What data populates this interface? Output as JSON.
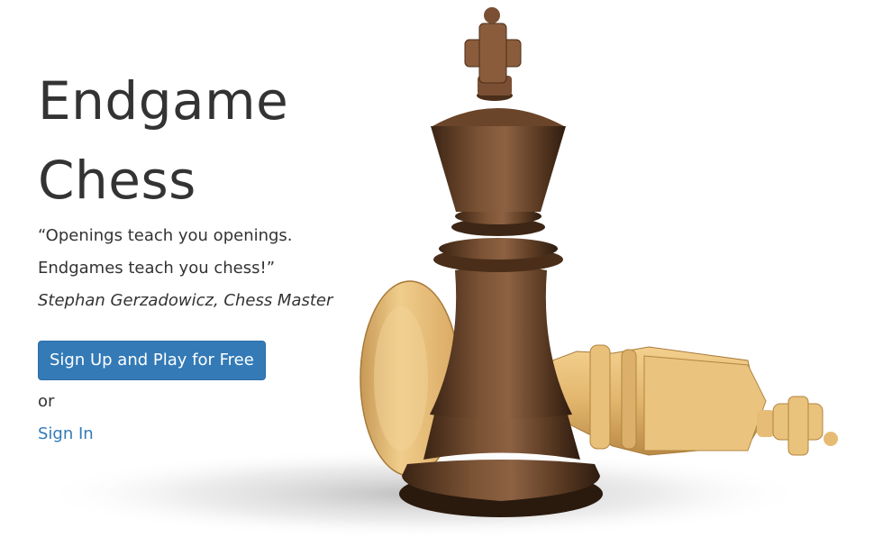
{
  "hero": {
    "title": "Endgame Chess",
    "quote_line_1": "“Openings teach you openings.",
    "quote_line_2": "Endgames teach you chess!”",
    "quote_author": "Stephan Gerzadowicz, Chess Master",
    "signup_label": "Sign Up and Play for Free",
    "or_text": "or",
    "signin_label": "Sign In",
    "image": "chess-kings-photo"
  },
  "colors": {
    "primary": "#337ab7",
    "text": "#333333",
    "dark_wood": "#5a3a22",
    "light_wood": "#e0b36e",
    "background": "#ffffff"
  }
}
